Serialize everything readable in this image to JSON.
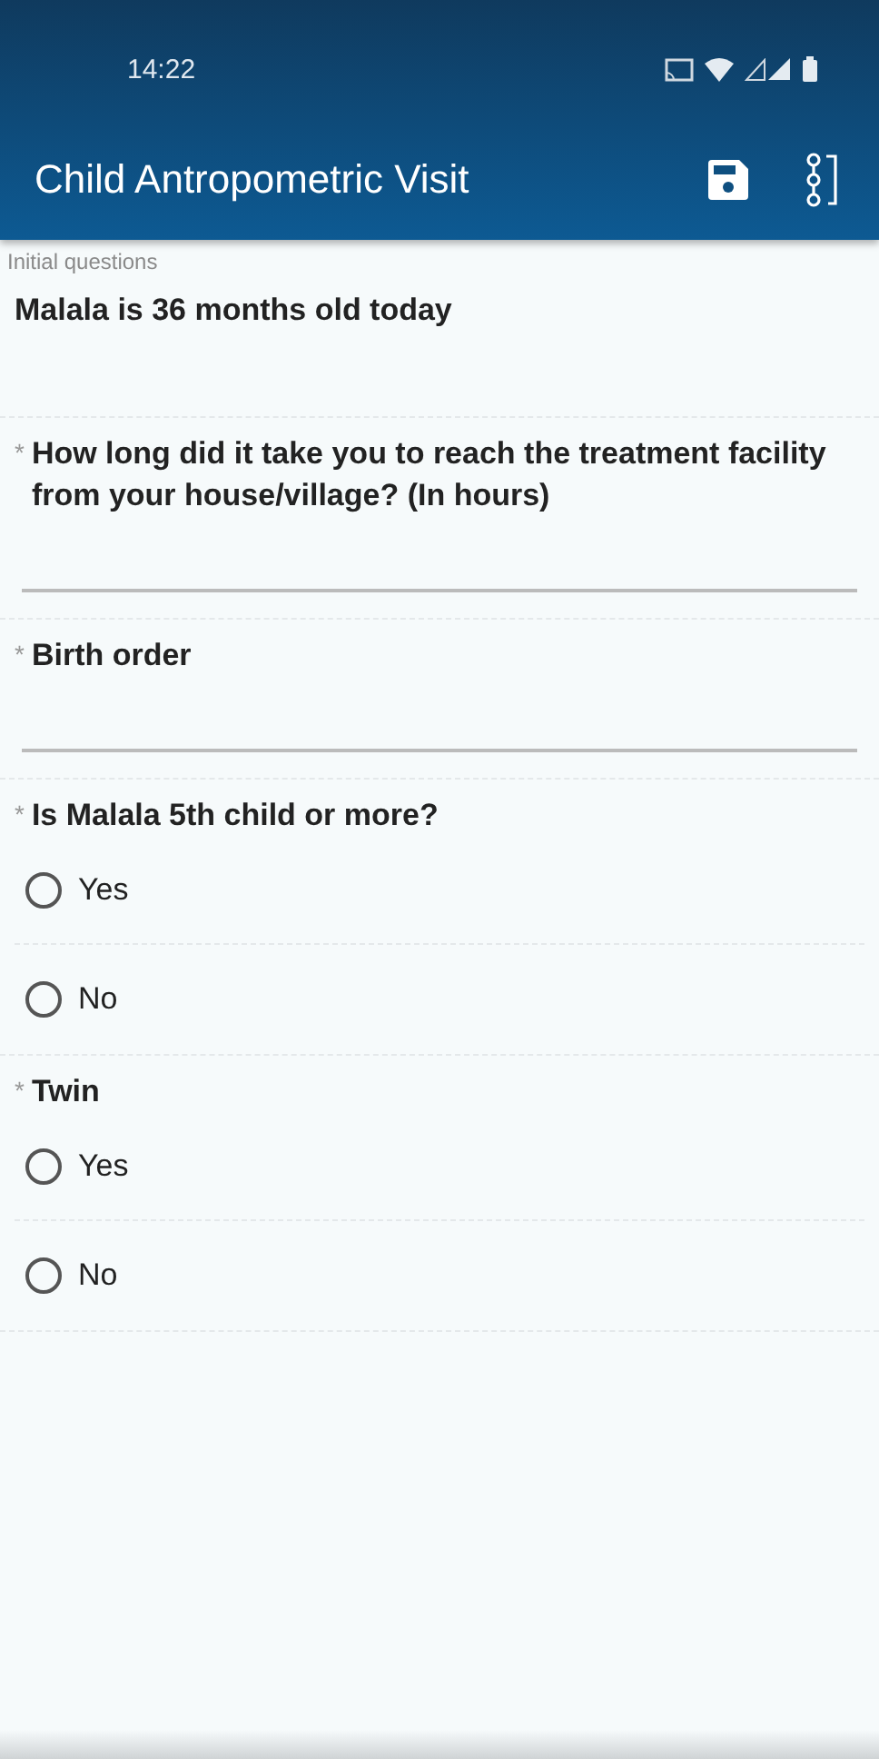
{
  "status_bar": {
    "time": "14:22"
  },
  "app_bar": {
    "title": "Child Antropometric Visit"
  },
  "section": {
    "title": "Initial questions"
  },
  "questions": [
    {
      "kind": "info",
      "label": "Malala is 36 months old today"
    },
    {
      "kind": "text",
      "mark": "*",
      "label": "How long did it take you to reach the treatment facility from your house/village? (In hours)"
    },
    {
      "kind": "text",
      "mark": "*",
      "label": "Birth order"
    },
    {
      "kind": "radio",
      "mark": "*",
      "label": "Is Malala 5th child or more?",
      "options": [
        {
          "label": "Yes",
          "selected": false
        },
        {
          "label": "No",
          "selected": false
        }
      ]
    },
    {
      "kind": "radio",
      "mark": "*",
      "label": "Twin",
      "options": [
        {
          "label": "Yes",
          "selected": false
        },
        {
          "label": "No",
          "selected": false
        }
      ]
    }
  ]
}
